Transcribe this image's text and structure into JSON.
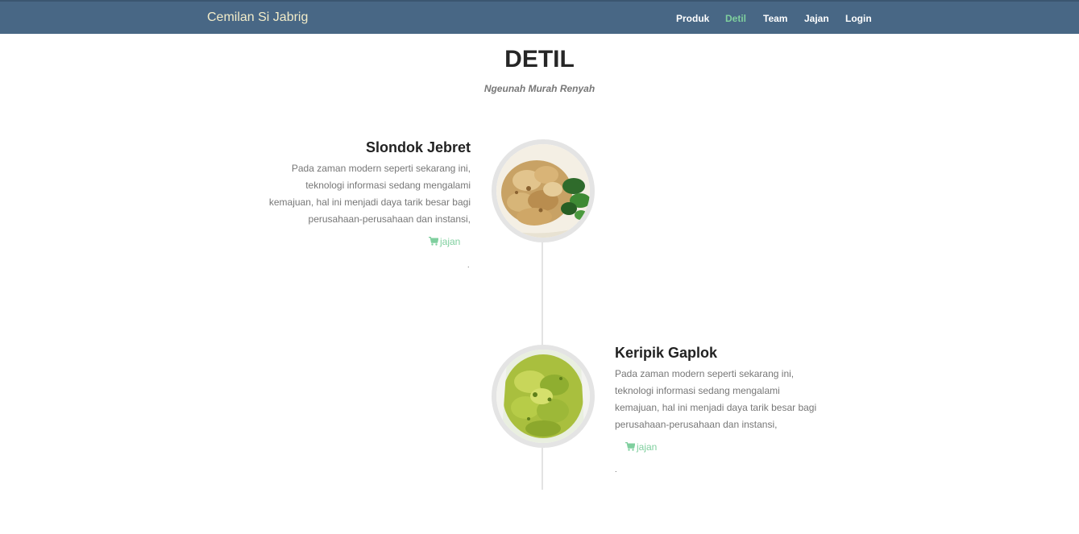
{
  "navbar": {
    "brand": "Cemilan Si Jabrig",
    "items": [
      {
        "label": "Produk",
        "active": false
      },
      {
        "label": "Detil",
        "active": true
      },
      {
        "label": "Team",
        "active": false
      },
      {
        "label": "Jajan",
        "active": false
      },
      {
        "label": "Login",
        "active": false
      }
    ]
  },
  "header": {
    "title": "DETIL",
    "subtitle": "Ngeunah Murah Renyah"
  },
  "timeline": [
    {
      "name": "Slondok Jebret",
      "description": "Pada zaman modern seperti sekarang ini, teknologi informasi sedang mengalami kemajuan, hal ini menjadi daya tarik besar bagi perusahaan-perusahaan dan instansi,",
      "link_label": "jajan",
      "icon": "cart-icon",
      "footnote": "."
    },
    {
      "name": "Keripik Gaplok",
      "description": "Pada zaman modern seperti sekarang ini, teknologi informasi sedang mengalami kemajuan, hal ini menjadi daya tarik besar bagi perusahaan-perusahaan dan instansi,",
      "link_label": "jajan",
      "icon": "cart-icon",
      "footnote": "."
    }
  ],
  "colors": {
    "navbar_bg": "#486785",
    "brand_text": "#f2ecc9",
    "accent": "#7fcf9e",
    "timeline_line": "#e3e3e3"
  }
}
